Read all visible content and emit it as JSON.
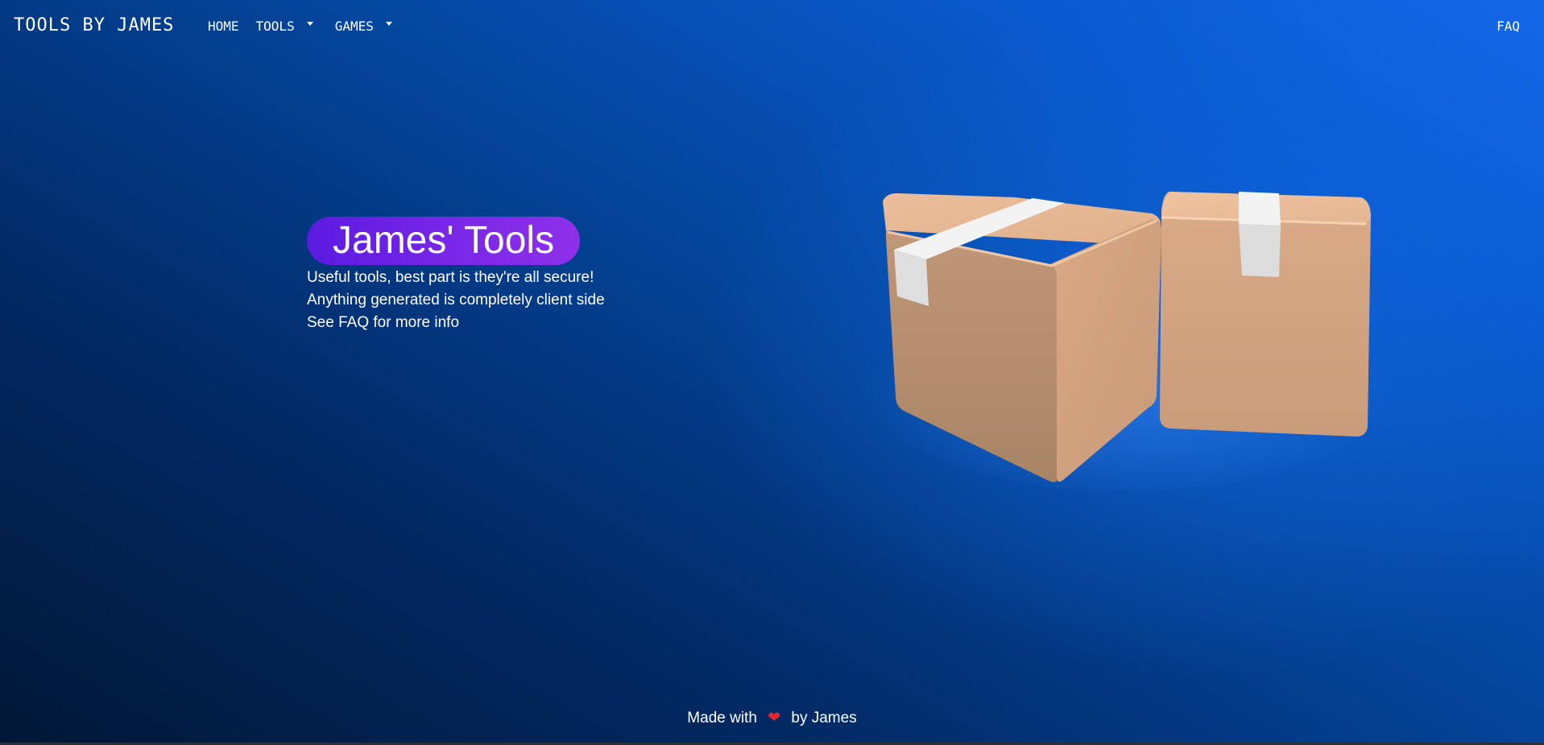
{
  "navbar": {
    "brand": "TOOLS BY JAMES",
    "home": "HOME",
    "tools": "TOOLS",
    "games": "GAMES",
    "faq": "FAQ"
  },
  "hero": {
    "title": "James' Tools",
    "lines": [
      "Useful tools, best part is they're all secure!",
      "Anything generated is completely client side",
      "See FAQ for more info"
    ]
  },
  "illustration": {
    "icon": "cardboard-boxes-icon"
  },
  "footer": {
    "before": "Made with",
    "heart": "❤",
    "after": "by James"
  },
  "colors": {
    "title_pill_start": "#5b1be0",
    "title_pill_end": "#8f30ea",
    "background_dark": "#011735",
    "background_light": "#1468e8",
    "heart": "#e5262e"
  }
}
